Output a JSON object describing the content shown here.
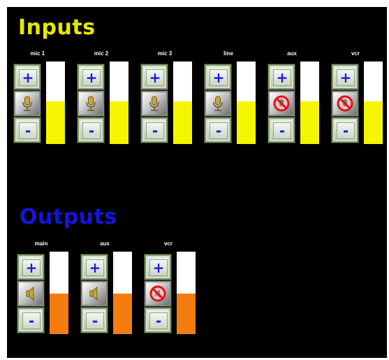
{
  "inputs": {
    "title": "Inputs",
    "channels": [
      {
        "label": "mic 1",
        "icon": "mic-icon",
        "muted": false,
        "level": 0.52
      },
      {
        "label": "mic 2",
        "icon": "mic-icon",
        "muted": false,
        "level": 0.52
      },
      {
        "label": "mic 3",
        "icon": "mic-icon",
        "muted": false,
        "level": 0.52
      },
      {
        "label": "line",
        "icon": "mic-icon",
        "muted": false,
        "level": 0.52
      },
      {
        "label": "aux",
        "icon": "muted-mic-icon",
        "muted": true,
        "level": 0.52
      },
      {
        "label": "vcr",
        "icon": "muted-mic-icon",
        "muted": true,
        "level": 0.52
      }
    ]
  },
  "outputs": {
    "title": "Outputs",
    "channels": [
      {
        "label": "main",
        "icon": "speaker-icon",
        "muted": false,
        "level": 0.49
      },
      {
        "label": "aux",
        "icon": "speaker-icon",
        "muted": false,
        "level": 0.49
      },
      {
        "label": "vcr",
        "icon": "muted-speaker-icon",
        "muted": true,
        "level": 0.49
      }
    ]
  },
  "buttons": {
    "plus": "+",
    "minus": "-"
  },
  "colors": {
    "background": "#000000",
    "inputs_title": "#e8e800",
    "outputs_title": "#1414e0",
    "input_meter": "#f5f500",
    "output_meter": "#f47c10",
    "button_symbol": "#1a1ae6",
    "mute_red": "#d81818"
  }
}
